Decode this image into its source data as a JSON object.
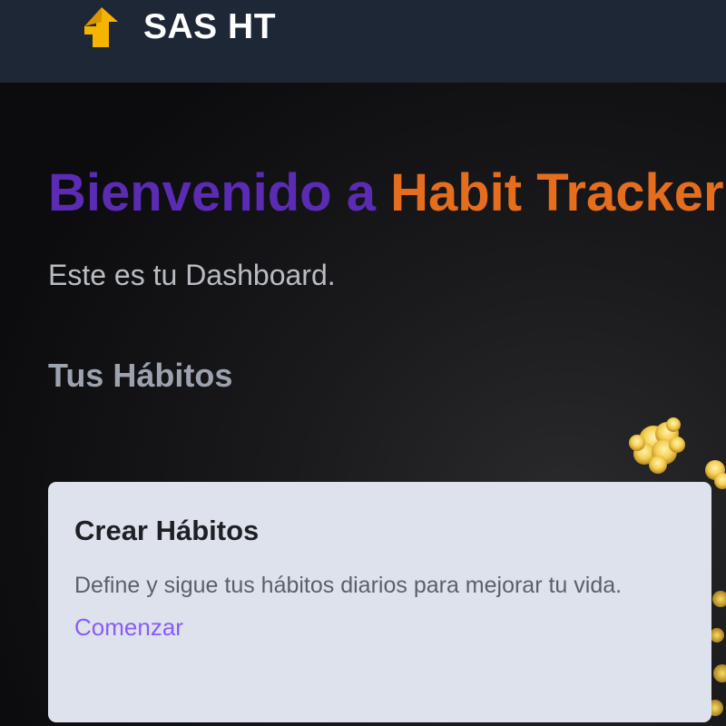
{
  "navbar": {
    "brand_icon": "house-arrow-icon",
    "brand_name": "SAS HT",
    "background_color": "#1e2736"
  },
  "hero": {
    "title_prefix": "Bienvenido a ",
    "title_accent": "Habit Tracker",
    "title_color": "#5b2bb3",
    "accent_color": "#e46d1e",
    "subtitle": "Este es tu Dashboard."
  },
  "habits_section": {
    "title": "Tus Hábitos"
  },
  "card": {
    "title": "Crear Hábitos",
    "description": "Define y sigue tus hábitos diarios para mejorar tu vida.",
    "link_label": "Comenzar",
    "link_color": "#8b5cf6"
  },
  "background_image": "yellow-flowers-photo"
}
